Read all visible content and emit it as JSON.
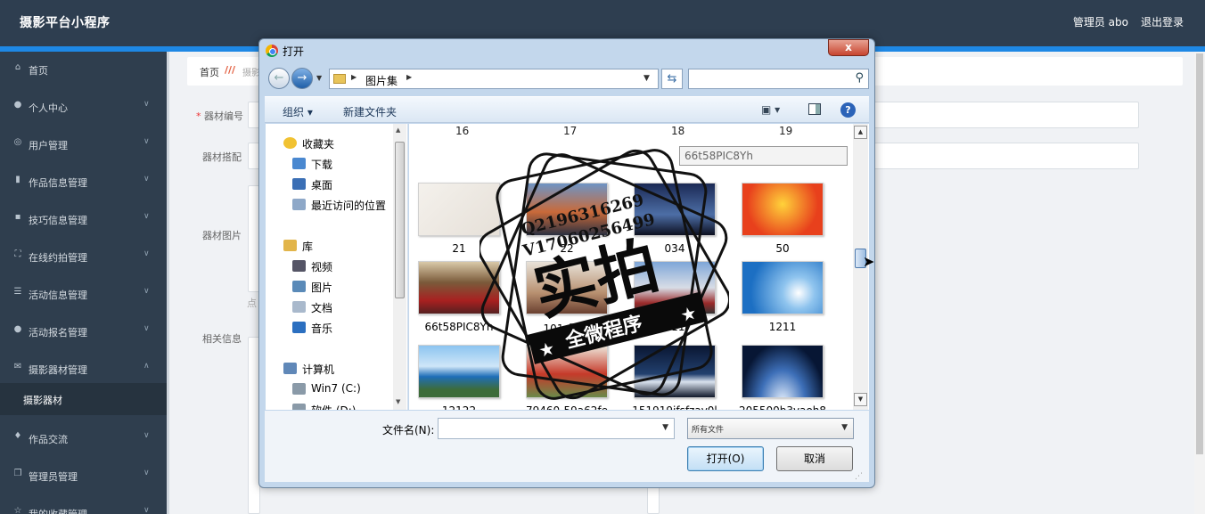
{
  "app": {
    "title": "摄影平台小程序",
    "admin": "管理员 abo",
    "logout": "退出登录"
  },
  "sidebar": {
    "items": [
      {
        "label": "首页",
        "icon": "home-icon",
        "glyph": "⌂"
      },
      {
        "label": "个人中心",
        "icon": "user-icon",
        "glyph": "●"
      },
      {
        "label": "用户管理",
        "icon": "users-icon",
        "glyph": "◎"
      },
      {
        "label": "作品信息管理",
        "icon": "pin-icon",
        "glyph": "▮"
      },
      {
        "label": "技巧信息管理",
        "icon": "briefcase-icon",
        "glyph": "▪"
      },
      {
        "label": "在线约拍管理",
        "icon": "frame-icon",
        "glyph": "⛶"
      },
      {
        "label": "活动信息管理",
        "icon": "list-icon",
        "glyph": "☰"
      },
      {
        "label": "活动报名管理",
        "icon": "location-icon",
        "glyph": "●"
      },
      {
        "label": "摄影器材管理",
        "icon": "mail-icon",
        "glyph": "✉"
      },
      {
        "label": "作品交流",
        "icon": "mic-icon",
        "glyph": "♦"
      },
      {
        "label": "管理员管理",
        "icon": "copy-icon",
        "glyph": "❐"
      },
      {
        "label": "我的收藏管理",
        "icon": "star-icon",
        "glyph": "☆"
      }
    ],
    "sub_active": "摄影器材"
  },
  "breadcrumb": {
    "home": "首页",
    "current": "摄影"
  },
  "form": {
    "equip_no_label": "器材编号",
    "equip_match_label": "器材搭配",
    "equip_image_label": "器材图片",
    "related_info_label": "相关信息",
    "click_hint": "点"
  },
  "dialog": {
    "title": "打开",
    "close": "x",
    "address": "图片集",
    "search_placeholder": "",
    "toolbar": {
      "organize": "组织 ▾",
      "new_folder": "新建文件夹",
      "help": "?"
    },
    "nav": [
      {
        "label": "收藏夹",
        "icon": "favorites-star-icon"
      },
      {
        "label": "下载",
        "icon": "downloads-folder-icon"
      },
      {
        "label": "桌面",
        "icon": "desktop-icon"
      },
      {
        "label": "最近访问的位置",
        "icon": "recent-places-icon"
      },
      {
        "label": "库",
        "icon": "library-folder-icon"
      },
      {
        "label": "视频",
        "icon": "video-library-icon"
      },
      {
        "label": "图片",
        "icon": "pictures-library-icon"
      },
      {
        "label": "文档",
        "icon": "documents-library-icon"
      },
      {
        "label": "音乐",
        "icon": "music-library-icon"
      },
      {
        "label": "计算机",
        "icon": "computer-icon"
      },
      {
        "label": "Win7 (C:)",
        "icon": "drive-icon"
      },
      {
        "label": "软件 (D:)",
        "icon": "drive-icon"
      }
    ],
    "headers": [
      "16",
      "17",
      "18",
      "19"
    ],
    "rename_value": "66t58PIC8Yh",
    "files": [
      {
        "name": "21",
        "bg": "linear-gradient(135deg,#f4f1ec,#e6e0d8)"
      },
      {
        "name": "22",
        "bg": "linear-gradient(#6e94c4 0%,#c96a3a 55%,#2b3040 100%)"
      },
      {
        "name": "034",
        "bg": "linear-gradient(#1b2a55,#4d6ea6 60%,#0c1020)"
      },
      {
        "name": "50",
        "bg": "radial-gradient(circle at 50% 40%,#ffd23a,#e8401c 70%)"
      },
      {
        "name": "66t58PIC8Yh",
        "bg": "linear-gradient(#d9c9a8 0%,#7a5a3a 40%,#a82020 75%,#552020 100%)"
      },
      {
        "name": "101_副本",
        "bg": "linear-gradient(#e8e2d8,#b89070 60%,#6a4030)"
      },
      {
        "name": "111",
        "bg": "linear-gradient(#7ea6d8,#d8dde6 50%,#9a2a2a 80%,#333)"
      },
      {
        "name": "1211",
        "bg": "radial-gradient(circle at 70% 60%,#ffffff 0,#8fc4ee 25%,#1c6fc3 75%)"
      },
      {
        "name": "12122",
        "bg": "linear-gradient(#8cc4f0 0%,#cfe6f8 40%,#1f6eb8 60%,#3d6c3a 85%)"
      },
      {
        "name": "79460-59a62fe",
        "bg": "linear-gradient(#eee8dc,#c63a2a 55%,#6a8a4a)"
      },
      {
        "name": "151919ifsfzav0l",
        "bg": "linear-gradient(#0a1632,#22406e 55%,#d9e2ee 70%,#10182a)"
      },
      {
        "name": "205500b3vaoh8",
        "bg": "radial-gradient(ellipse at 50% 110%,#e8f2ff 0,#3d6fb8 40%,#071634 75%)"
      }
    ],
    "filename_label": "文件名(N):",
    "filename_value": "",
    "filetype": "所有文件",
    "open_button": "打开(O)",
    "cancel_button": "取消"
  },
  "stamp": {
    "line1": "Q2196316269",
    "line2": "V17060256499",
    "main": "实拍",
    "sub": "全微程序"
  }
}
